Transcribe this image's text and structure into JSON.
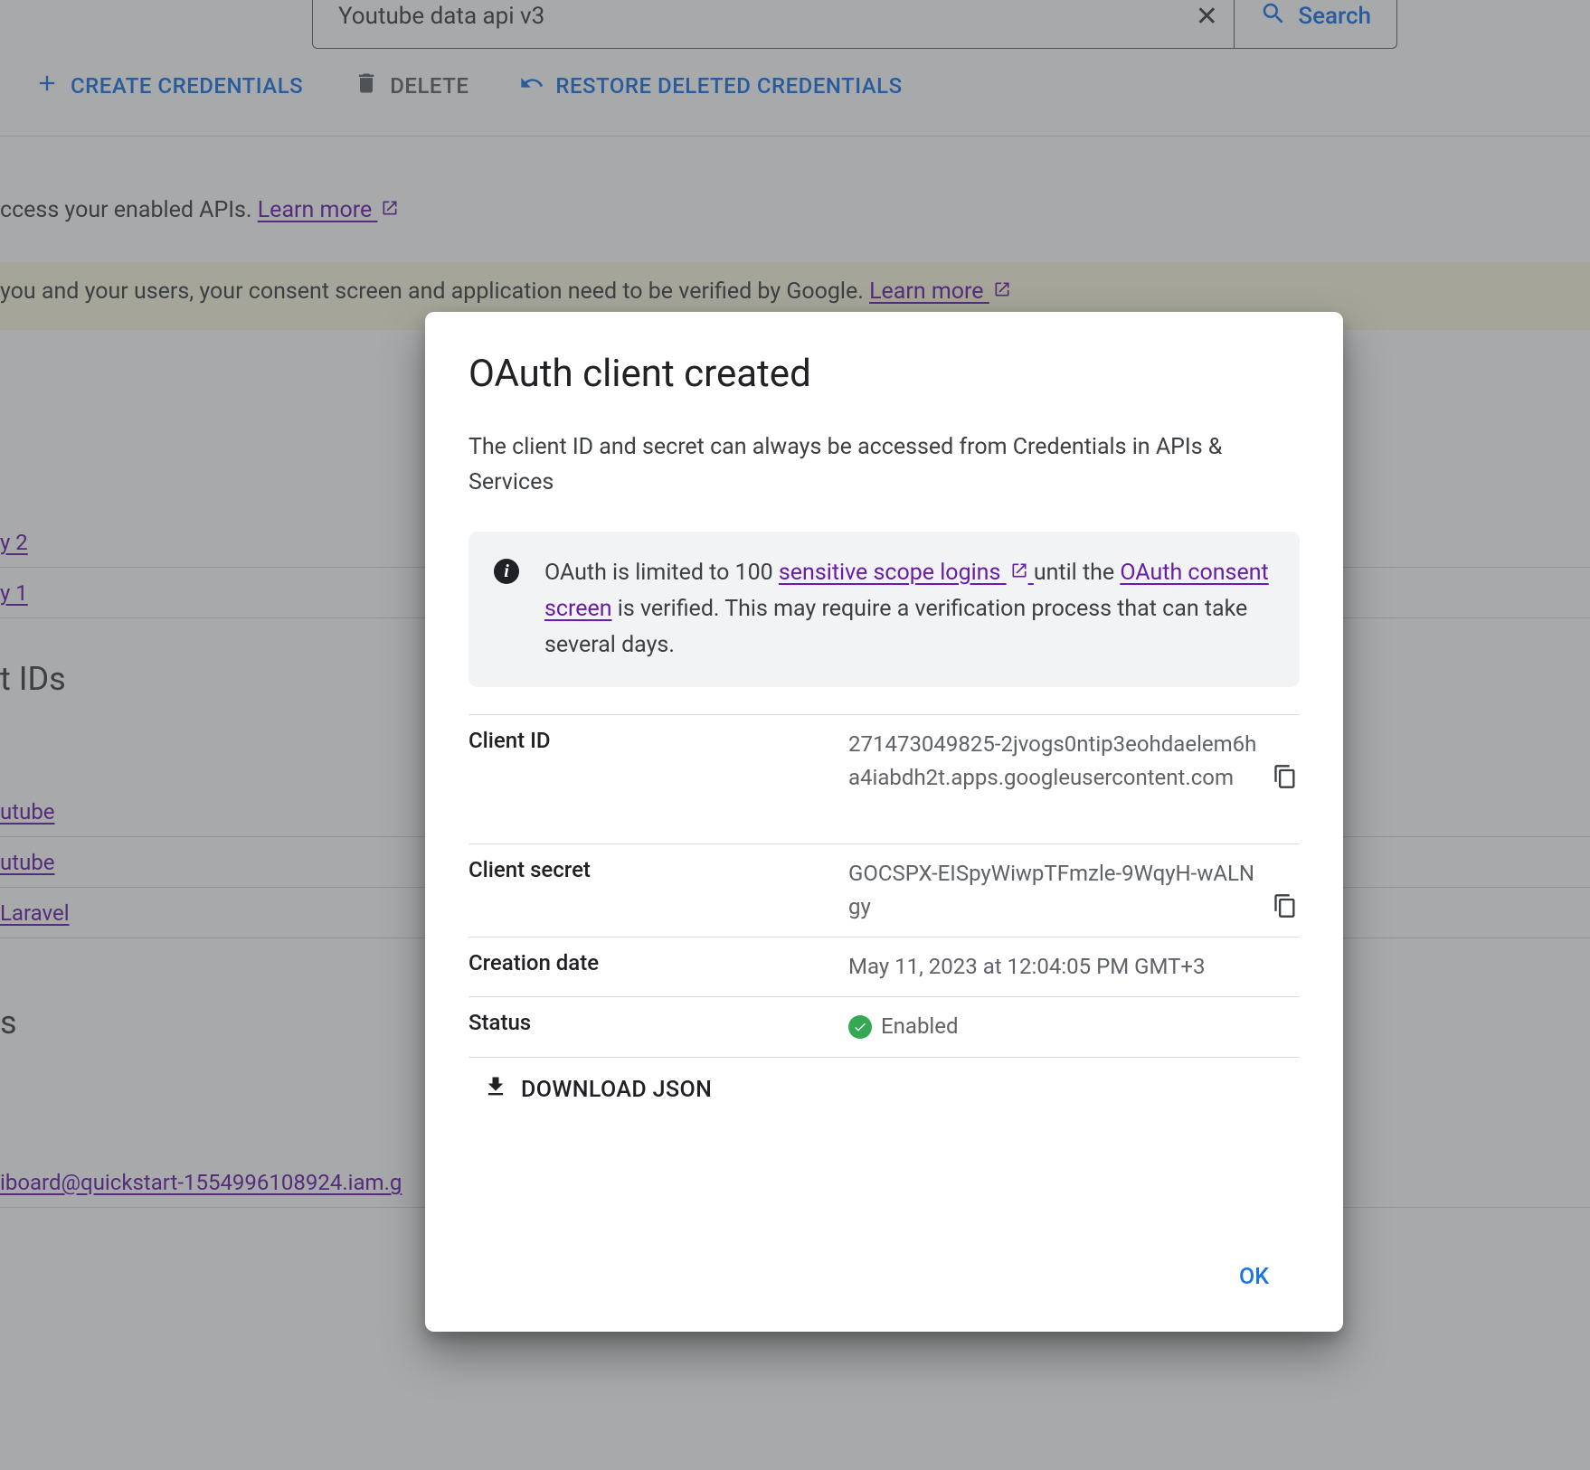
{
  "search": {
    "value": "Youtube data api v3",
    "button": "Search"
  },
  "toolbar": {
    "create": "CREATE CREDENTIALS",
    "delete": "DELETE",
    "restore": "RESTORE DELETED CREDENTIALS"
  },
  "banner1": {
    "text": "ccess your enabled APIs. ",
    "link": "Learn more"
  },
  "banner2": {
    "text": "you and your users, your consent screen and application need to be verified by Google. ",
    "link": "Learn more"
  },
  "rows": {
    "r1": "y 2",
    "r2": "y 1",
    "hdr1": "t IDs",
    "r3": "utube",
    "r4": "utube",
    "r5": "Laravel",
    "hdr2": "s",
    "r6": "iboard@quickstart-1554996108924.iam.g"
  },
  "dialog": {
    "title": "OAuth client created",
    "sub": "The client ID and secret can always be accessed from Credentials in APIs & Services",
    "info": {
      "p1": "OAuth is limited to 100 ",
      "link1": "sensitive scope logins",
      "p2": " until the ",
      "link2": "OAuth consent screen",
      "p3": " is verified. This may require a verification process that can take several days."
    },
    "fields": {
      "client_id_label": "Client ID",
      "client_id_value": "271473049825-2jvogs0ntip3eohdaelem6ha4iabdh2t.apps.googleusercontent.com",
      "client_secret_label": "Client secret",
      "client_secret_value": "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",
      "creation_label": "Creation date",
      "creation_value": "May 11, 2023 at 12:04:05 PM GMT+3",
      "status_label": "Status",
      "status_value": "Enabled"
    },
    "download": "DOWNLOAD JSON",
    "ok": "OK"
  },
  "colors": {
    "primary": "#1a73e8",
    "visited": "#681da8",
    "success": "#34a853"
  }
}
